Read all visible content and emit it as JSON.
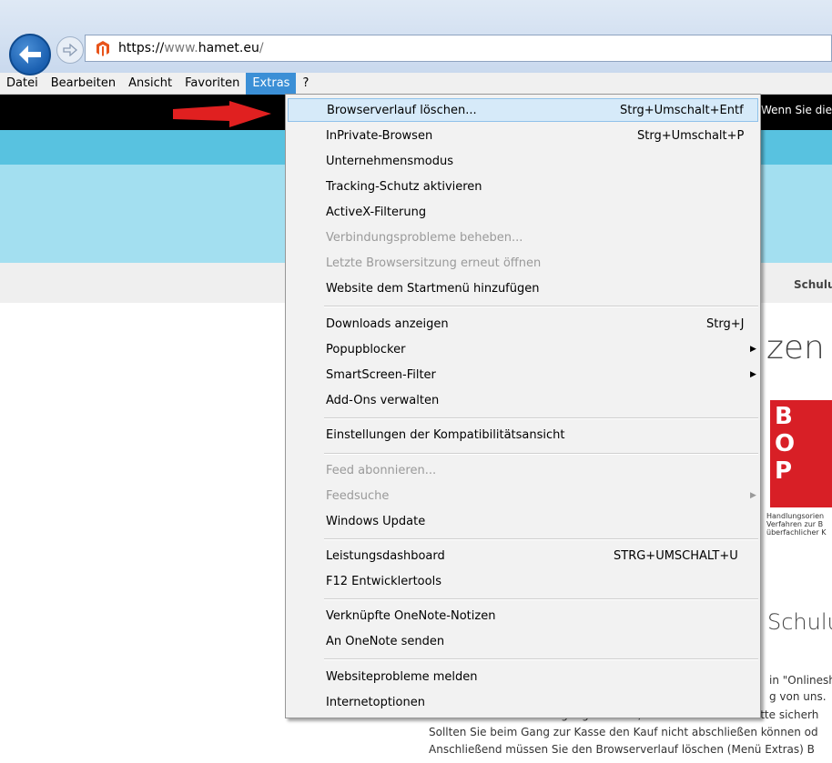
{
  "browser": {
    "url_protocol": "https://",
    "url_subdomain": "www.",
    "url_host": "hamet.eu",
    "url_path": "/"
  },
  "menubar": [
    "Datei",
    "Bearbeiten",
    "Ansicht",
    "Favoriten",
    "Extras",
    "?"
  ],
  "page": {
    "blackbar_text": "Wenn Sie die",
    "nav_schulu": "Schulu",
    "heading_zen": "zen",
    "bop_letters": [
      "B",
      "O",
      "P"
    ],
    "bop_desc": [
      "Handlungsorien",
      "Verfahren zur B",
      "überfachlicher K"
    ],
    "heading_schulu": "Schulu",
    "body_lines": [
      "in \"Onlinesh",
      "g von uns.",
      "Sollten Sie keine Bestätigung erhalten, so melden Sie sich bitte sicherh",
      "Sollten Sie beim Gang zur Kasse den Kauf nicht abschließen können od",
      "Anschließend müssen Sie den Browserverlauf löschen (Menü Extras) B"
    ]
  },
  "extras_menu": {
    "items": [
      {
        "label": "Browserverlauf löschen...",
        "shortcut": "Strg+Umschalt+Entf",
        "highlighted": true
      },
      {
        "label": "InPrivate-Browsen",
        "shortcut": "Strg+Umschalt+P"
      },
      {
        "label": "Unternehmensmodus"
      },
      {
        "label": "Tracking-Schutz aktivieren"
      },
      {
        "label": "ActiveX-Filterung"
      },
      {
        "label": "Verbindungsprobleme beheben...",
        "disabled": true
      },
      {
        "label": "Letzte Browsersitzung erneut öffnen",
        "disabled": true
      },
      {
        "label": "Website dem Startmenü hinzufügen"
      },
      {
        "label": "Downloads anzeigen",
        "shortcut": "Strg+J"
      },
      {
        "label": "Popupblocker",
        "submenu": true
      },
      {
        "label": "SmartScreen-Filter",
        "submenu": true
      },
      {
        "label": "Add-Ons verwalten"
      },
      {
        "label": "Einstellungen der Kompatibilitätsansicht"
      },
      {
        "label": "Feed abonnieren...",
        "disabled": true
      },
      {
        "label": "Feedsuche",
        "disabled": true,
        "submenu": true
      },
      {
        "label": "Windows Update"
      },
      {
        "label": "Leistungsdashboard",
        "shortcut": "STRG+UMSCHALT+U"
      },
      {
        "label": "F12 Entwicklertools"
      },
      {
        "label": "Verknüpfte OneNote-Notizen"
      },
      {
        "label": "An OneNote senden"
      },
      {
        "label": "Websiteprobleme melden"
      },
      {
        "label": "Internetoptionen"
      }
    ]
  },
  "colors": {
    "accent": "#3b8fd6",
    "highlight": "#d6eaf9",
    "cyan": "#58c2e0",
    "light_cyan": "#a3dff0",
    "bop_red": "#d81f26",
    "arrow_red": "#e02020"
  },
  "icons": [
    "back-arrow-icon",
    "forward-arrow-icon",
    "site-favicon-icon",
    "submenu-arrow-icon",
    "red-pointer-arrow-icon"
  ]
}
